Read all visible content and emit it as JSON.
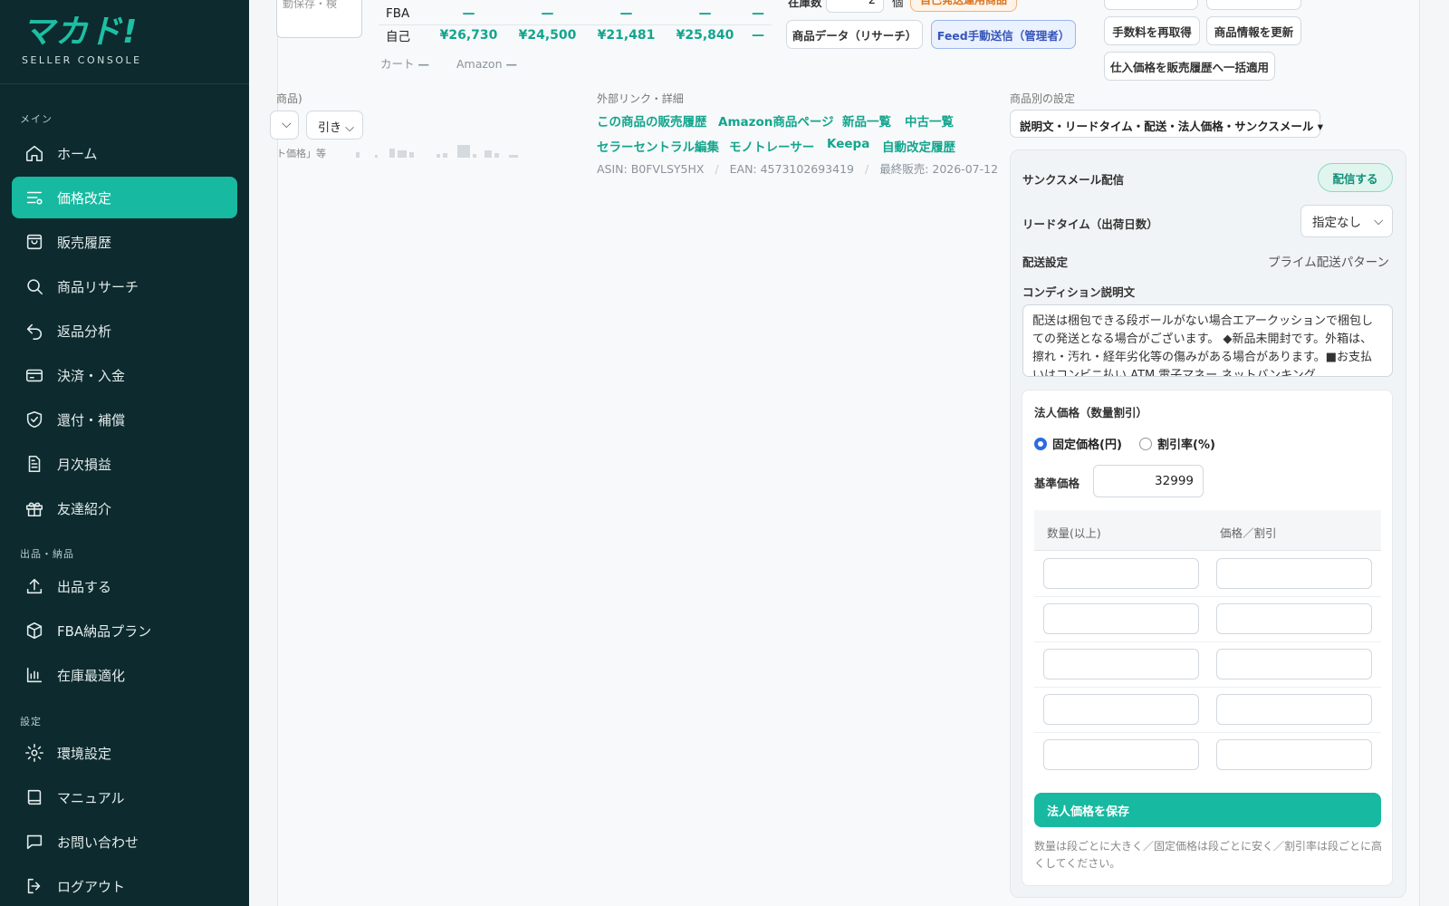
{
  "app": {
    "logo": "マカド!",
    "subtitle": "SELLER CONSOLE"
  },
  "sidebar": {
    "sections": [
      {
        "label": "メイン"
      },
      {
        "label": "出品・納品"
      },
      {
        "label": "設定"
      }
    ],
    "items": [
      {
        "label": "ホーム",
        "icon": "home-icon"
      },
      {
        "label": "価格改定",
        "icon": "sliders-icon",
        "active": true
      },
      {
        "label": "販売履歴",
        "icon": "bag-icon"
      },
      {
        "label": "商品リサーチ",
        "icon": "search-icon"
      },
      {
        "label": "返品分析",
        "icon": "return-icon"
      },
      {
        "label": "決済・入金",
        "icon": "card-icon"
      },
      {
        "label": "還付・補償",
        "icon": "shield-icon"
      },
      {
        "label": "月次損益",
        "icon": "document-icon"
      },
      {
        "label": "友達紹介",
        "icon": "gift-icon"
      },
      {
        "label": "出品する",
        "icon": "upload-icon"
      },
      {
        "label": "FBA納品プラン",
        "icon": "box-icon"
      },
      {
        "label": "在庫最適化",
        "icon": "chart-icon"
      },
      {
        "label": "環境設定",
        "icon": "gear-icon"
      },
      {
        "label": "マニュアル",
        "icon": "book-icon"
      },
      {
        "label": "お問い合わせ",
        "icon": "chat-icon"
      },
      {
        "label": "ログアウト",
        "icon": "logout-icon"
      }
    ]
  },
  "top": {
    "textarea_partial": "動保存・検",
    "price_rows": [
      {
        "label": "FBA",
        "values": [
          "—",
          "—",
          "—",
          "—",
          "—"
        ]
      },
      {
        "label": "自己",
        "values": [
          "¥26,730",
          "¥24,500",
          "¥21,481",
          "¥25,840",
          "—"
        ]
      }
    ],
    "cart_label": "カート",
    "cart_value": "—",
    "amazon_label": "Amazon",
    "amazon_value": "—",
    "stock_label": "在庫数",
    "stock_value": "2",
    "stock_unit": "個",
    "self_ship_badge": "自己発送運用商品",
    "btn_research": "商品データ（リサーチ）",
    "btn_feed": "Feed手動送信（管理者）",
    "btn_refetch_fee": "手数料を再取得",
    "btn_update_info": "商品情報を更新",
    "btn_apply_cost": "仕入価格を販売履歴へ一括適用"
  },
  "left_mid": {
    "header_partial": "商品)",
    "select_pull": "引き",
    "note_partial": "ト価格」等"
  },
  "links": {
    "header": "外部リンク・詳細",
    "row1": [
      "この商品の販売履歴",
      "Amazon商品ページ",
      "新品一覧",
      "中古一覧"
    ],
    "row2": [
      "セラーセントラル編集",
      "モノトレーサー",
      "Keepa",
      "自動改定履歴"
    ],
    "asin": "ASIN: B0FVLSY5HX",
    "ean": "EAN: 4573102693419",
    "last_sale": "最終販売: 2026-07-12"
  },
  "settings": {
    "header": "商品別の設定",
    "dropdown": "説明文・リードタイム・配送・法人価格・サンクスメール",
    "thanks_label": "サンクスメール配信",
    "thanks_btn": "配信する",
    "lead_label": "リードタイム（出荷日数）",
    "lead_value": "指定なし",
    "ship_label": "配送設定",
    "ship_value": "プライム配送パターン",
    "cond_label": "コンディション説明文",
    "cond_text": "配送は梱包できる段ボールがない場合エアークッションで梱包しての発送となる場合がございます。 ◆新品未開封です。外箱は、擦れ・汚れ・経年劣化等の傷みがある場合があります。■お支払いはコンビニ払い ATM 電子マネー ネットバンキング"
  },
  "corp": {
    "title": "法人価格（数量割引）",
    "radio_fixed": "固定価格(円)",
    "radio_rate": "割引率(%)",
    "base_label": "基準価格",
    "base_value": "32999",
    "col_qty": "数量(以上)",
    "col_price": "価格／割引",
    "save": "法人価格を保存",
    "note": "数量は段ごとに大きく／固定価格は段ごとに安く／割引率は段ごとに高くしてください。"
  }
}
